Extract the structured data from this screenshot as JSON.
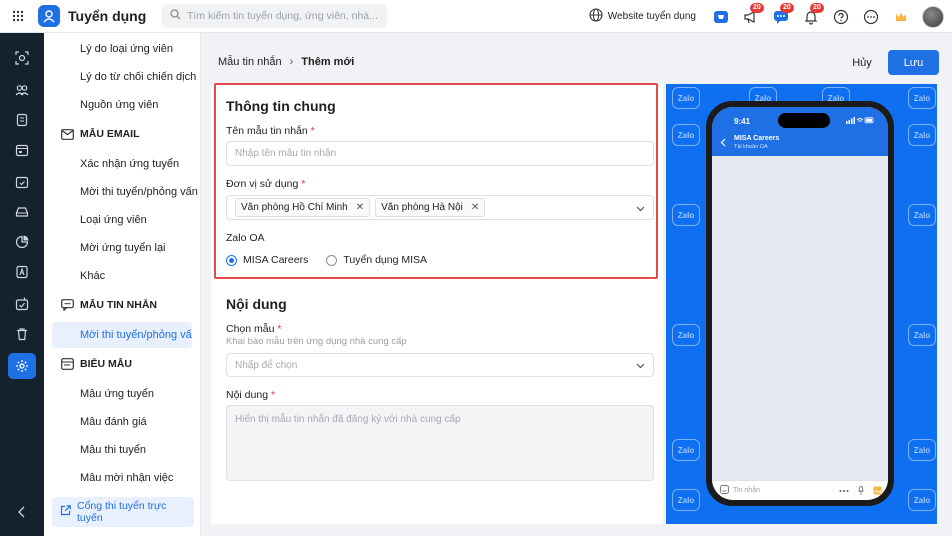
{
  "app": {
    "title": "Tuyển dụng"
  },
  "search": {
    "placeholder": "Tìm kiếm tin tuyển dụng, ứng viên, nhà..."
  },
  "topbar": {
    "website_label": "Website tuyển dụng",
    "badges": [
      "20",
      "20",
      "20"
    ]
  },
  "menu": {
    "items_top": [
      "Lý do loại ứng viên",
      "Lý do từ chối chiến dịch",
      "Nguồn ứng viên"
    ],
    "email_header": "MẪU EMAIL",
    "email_items": [
      "Xác nhận ứng tuyển",
      "Mời thi tuyển/phỏng vấn",
      "Loại ứng viên",
      "Mời ứng tuyển lại",
      "Khác"
    ],
    "message_header": "MẪU TIN NHẮN",
    "message_items": [
      "Mời thi tuyển/phỏng vấn"
    ],
    "form_header": "BIỂU MẪU",
    "form_items": [
      "Mẫu ứng tuyển",
      "Mẫu đánh giá",
      "Mẫu thi tuyển",
      "Mẫu mời nhận việc"
    ],
    "portal_label": "Cổng thi tuyển trực tuyến"
  },
  "breadcrumb": {
    "parent": "Mẫu tin nhắn",
    "current": "Thêm mới"
  },
  "actions": {
    "cancel": "Hủy",
    "save": "Lưu"
  },
  "general": {
    "title": "Thông tin chung",
    "name_label": "Tên mẫu tin nhắn",
    "name_placeholder": "Nhập tên mẫu tin nhắn",
    "unit_label": "Đơn vị sử dụng",
    "units": [
      "Văn phòng Hồ Chí Minh",
      "Văn phòng Hà Nội"
    ],
    "zalo_label": "Zalo OA",
    "zalo_options": [
      "MISA Careers",
      "Tuyển dụng MISA"
    ],
    "zalo_selected": "MISA Careers"
  },
  "content": {
    "title": "Nội dung",
    "template_label": "Chọn mẫu",
    "template_hint": "Khai báo mẫu trên ứng dụng nhà cung cấp",
    "template_placeholder": "Nhấp để chọn",
    "body_label": "Nội dung",
    "body_placeholder": "Hiển thị mẫu tin nhắn đã đăng ký với nhà cung cấp"
  },
  "preview": {
    "watermark": "Zalo",
    "time": "9:41",
    "account_name": "MISA Careers",
    "account_type": "Tài khoản OA",
    "input_placeholder": "Tin nhắn"
  },
  "colors": {
    "brand": "#1f6fe5",
    "highlight_border": "#e04a4a",
    "preview_bg": "#0e6ff0",
    "required": "#e53935"
  }
}
